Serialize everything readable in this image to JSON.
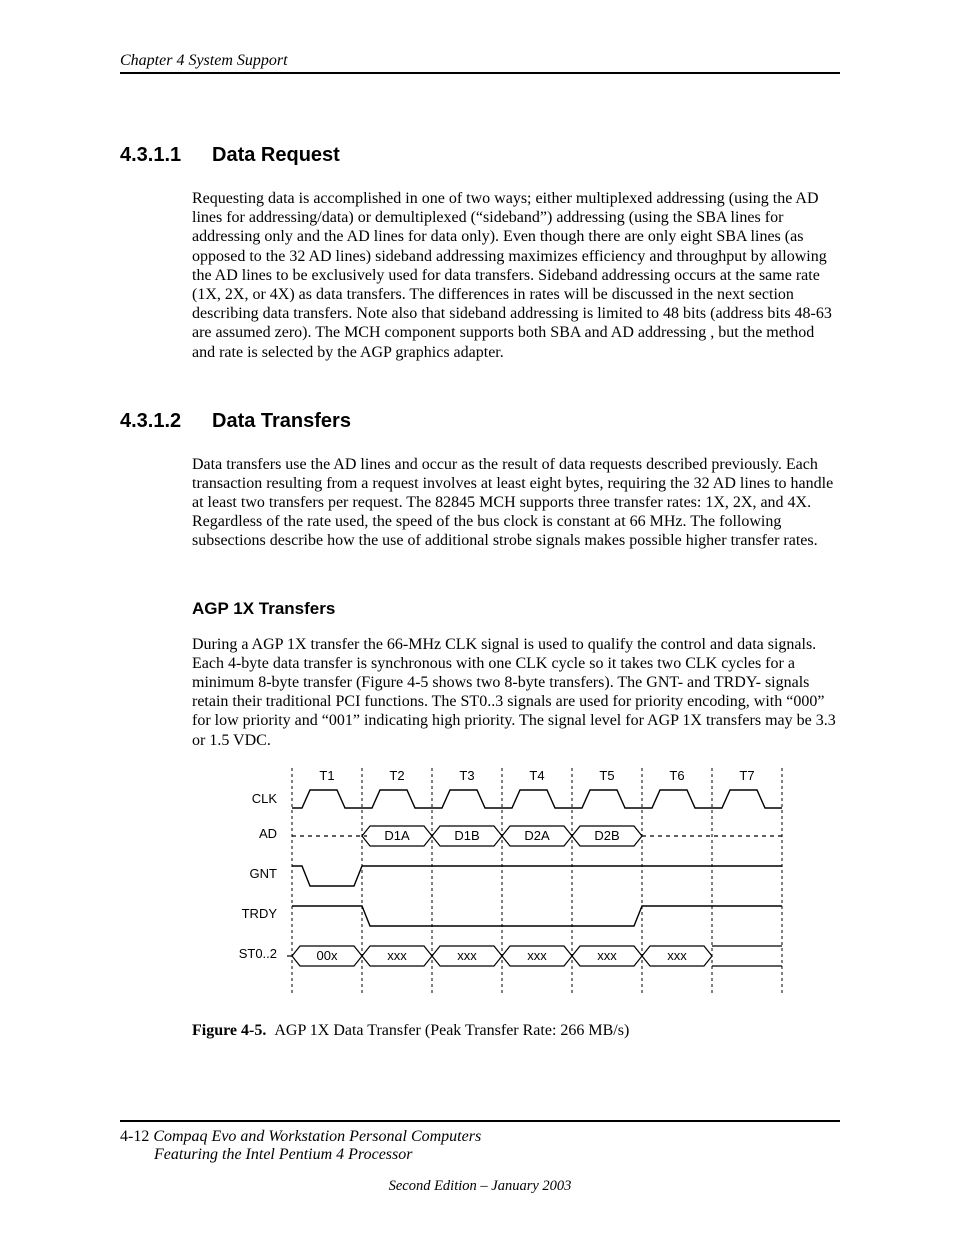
{
  "header": {
    "running": "Chapter 4  System Support"
  },
  "sec1": {
    "num": "4.3.1.1",
    "title": "Data Request",
    "body": "Requesting data is accomplished in one of two ways; either multiplexed addressing (using the AD lines for addressing/data) or demultiplexed (“sideband”) addressing (using the SBA lines for addressing only and the AD lines for data only). Even though there are only eight SBA lines (as opposed to the 32 AD lines) sideband addressing maximizes efficiency and throughput by allowing the AD lines to be exclusively used for data transfers.  Sideband addressing occurs at the same rate (1X, 2X, or 4X) as data transfers. The differences in rates will be discussed in the next section describing data transfers. Note also that sideband addressing is limited to 48 bits (address bits 48-63 are assumed zero). The MCH component supports both SBA and AD addressing , but the method and rate is selected by the AGP graphics adapter."
  },
  "sec2": {
    "num": "4.3.1.2",
    "title": "Data Transfers",
    "body": "Data transfers use the AD lines and occur as the result of data requests described previously. Each transaction resulting from a request involves at least eight bytes, requiring the 32 AD lines to handle at least two transfers per request. The 82845 MCH supports three transfer rates: 1X, 2X, and 4X. Regardless of the rate used, the speed of the bus clock is constant at 66 MHz. The following subsections describe how the use of additional strobe signals makes possible higher transfer rates."
  },
  "sub1": {
    "title": "AGP 1X Transfers",
    "body": "During a AGP 1X transfer the 66-MHz CLK signal is used to qualify the control and data signals. Each 4-byte data transfer is synchronous with one CLK cycle so it takes two CLK cycles for a minimum 8-byte transfer (Figure 4-5 shows two 8-byte transfers). The GNT- and TRDY- signals retain their traditional PCI functions. The ST0..3 signals are used for priority encoding, with “000” for low priority and “001” indicating high priority.  The signal level for AGP 1X transfers may be 3.3 or 1.5 VDC."
  },
  "diagram": {
    "ticks": [
      "T1",
      "T2",
      "T3",
      "T4",
      "T5",
      "T6",
      "T7"
    ],
    "signals": [
      "CLK",
      "AD",
      "GNT",
      "TRDY",
      "ST0..2"
    ],
    "ad_cells": [
      "D1A",
      "D1B",
      "D2A",
      "D2B"
    ],
    "st_cells": [
      "00x",
      "xxx",
      "xxx",
      "xxx",
      "xxx",
      "xxx"
    ]
  },
  "figcap": {
    "label": "Figure 4-5.",
    "text": "AGP 1X Data Transfer (Peak Transfer Rate: 266 MB/s)"
  },
  "footer": {
    "pagenum": "4-12",
    "title1": "Compaq Evo and Workstation Personal Computers",
    "title2": "Featuring the Intel Pentium 4 Processor",
    "edition": "Second Edition – January 2003"
  }
}
